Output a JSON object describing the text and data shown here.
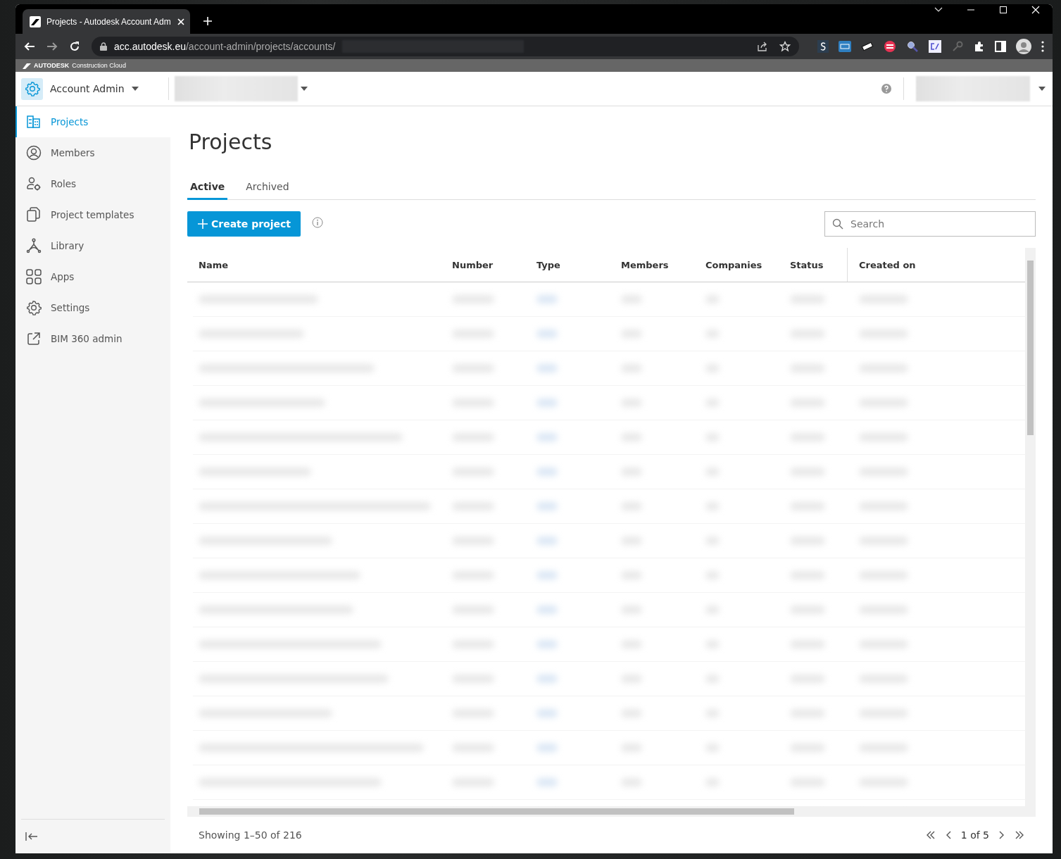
{
  "browser": {
    "tab_title": "Projects - Autodesk Account Adm",
    "url_host": "acc.autodesk.eu",
    "url_path": "/account-admin/projects/accounts/"
  },
  "brand": {
    "name": "AUTODESK",
    "product": "Construction Cloud"
  },
  "header": {
    "app_name": "Account Admin"
  },
  "sidebar": {
    "items": [
      {
        "label": "Projects",
        "selected": true
      },
      {
        "label": "Members",
        "selected": false
      },
      {
        "label": "Roles",
        "selected": false
      },
      {
        "label": "Project templates",
        "selected": false
      },
      {
        "label": "Library",
        "selected": false
      },
      {
        "label": "Apps",
        "selected": false
      },
      {
        "label": "Settings",
        "selected": false
      },
      {
        "label": "BIM 360 admin",
        "selected": false
      }
    ]
  },
  "page": {
    "title": "Projects",
    "tabs": [
      {
        "label": "Active",
        "selected": true
      },
      {
        "label": "Archived",
        "selected": false
      }
    ],
    "create_button": "Create project",
    "search": {
      "placeholder": "Search"
    },
    "table": {
      "columns": [
        "Name",
        "Number",
        "Type",
        "Members",
        "Companies",
        "Status",
        "Created on"
      ]
    },
    "footer": {
      "showing": "Showing 1–50 of 216",
      "page": "1 of 5"
    }
  }
}
